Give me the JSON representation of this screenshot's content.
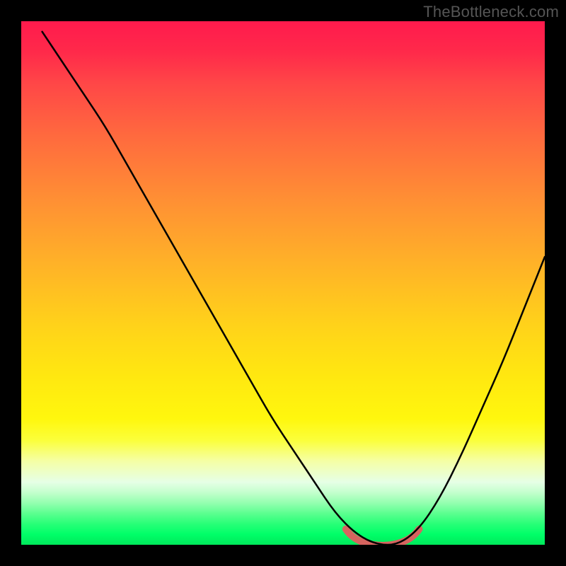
{
  "watermark": "TheBottleneck.com",
  "chart_data": {
    "type": "line",
    "title": "",
    "xlabel": "",
    "ylabel": "",
    "xlim": [
      0,
      100
    ],
    "ylim": [
      0,
      100
    ],
    "x": [
      4,
      8,
      12,
      16,
      20,
      24,
      28,
      32,
      36,
      40,
      44,
      48,
      52,
      56,
      60,
      64,
      68,
      72,
      76,
      80,
      84,
      88,
      92,
      96,
      100
    ],
    "y": [
      98,
      92,
      86,
      80,
      73,
      66,
      59,
      52,
      45,
      38,
      31,
      24,
      18,
      12,
      6,
      2,
      0,
      0,
      3,
      9,
      17,
      26,
      35,
      45,
      55
    ],
    "trough_highlight_x": [
      62,
      76
    ],
    "background_gradient": {
      "orientation": "vertical",
      "stops": [
        {
          "pos": 0.0,
          "color": "#ff1a4d"
        },
        {
          "pos": 0.8,
          "color": "#fbff3a"
        },
        {
          "pos": 0.9,
          "color": "#c4ffcd"
        },
        {
          "pos": 1.0,
          "color": "#00e85b"
        }
      ]
    }
  }
}
